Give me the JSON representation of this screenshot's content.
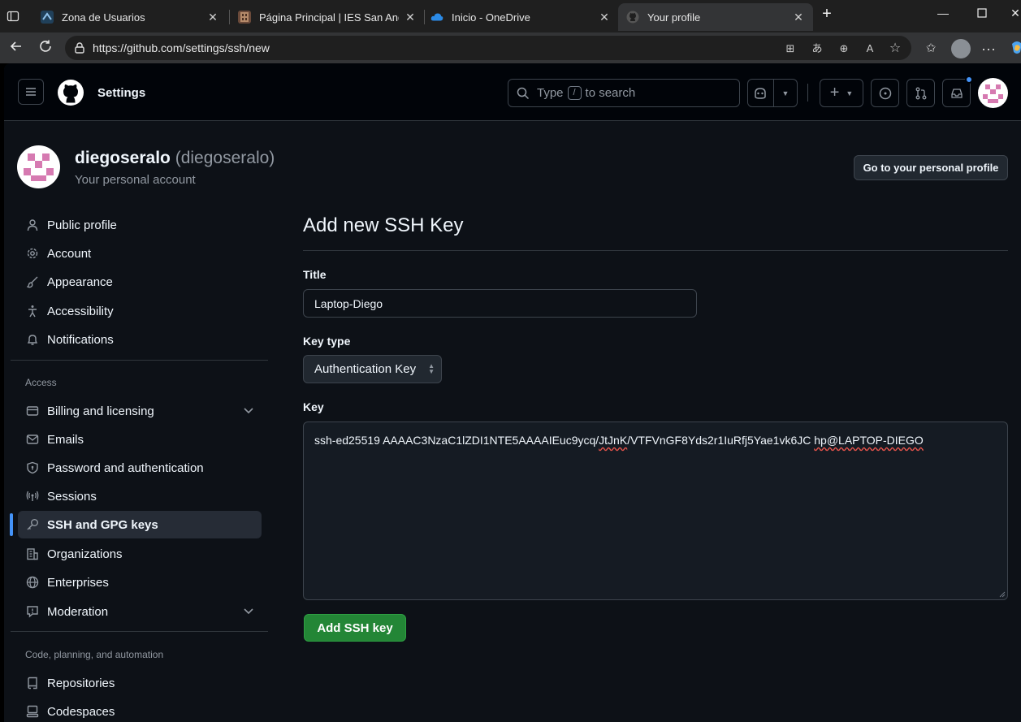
{
  "browser": {
    "tabs": [
      {
        "label": "Zona de Usuarios",
        "icon": "moodle-icon"
      },
      {
        "label": "Página Principal | IES San Andrés",
        "icon": "school-icon"
      },
      {
        "label": "Inicio - OneDrive",
        "icon": "onedrive-icon"
      },
      {
        "label": "Your profile",
        "icon": "github-icon",
        "active": true
      }
    ],
    "url": "https://github.com/settings/ssh/new"
  },
  "header": {
    "title": "Settings",
    "search_prefix": "Type",
    "search_key": "/",
    "search_suffix": "to search"
  },
  "profile": {
    "name": "diegoseralo",
    "handle": "(diegoseralo)",
    "subtitle": "Your personal account",
    "go_profile_label": "Go to your personal profile"
  },
  "sidebar": {
    "items": [
      {
        "label": "Public profile",
        "icon": "person-icon"
      },
      {
        "label": "Account",
        "icon": "gear-icon"
      },
      {
        "label": "Appearance",
        "icon": "paintbrush-icon"
      },
      {
        "label": "Accessibility",
        "icon": "accessibility-icon"
      },
      {
        "label": "Notifications",
        "icon": "bell-icon"
      }
    ],
    "access_heading": "Access",
    "access_items": [
      {
        "label": "Billing and licensing",
        "icon": "credit-card-icon",
        "expandable": true
      },
      {
        "label": "Emails",
        "icon": "mail-icon"
      },
      {
        "label": "Password and authentication",
        "icon": "shield-lock-icon"
      },
      {
        "label": "Sessions",
        "icon": "broadcast-icon"
      },
      {
        "label": "SSH and GPG keys",
        "icon": "key-icon",
        "selected": true
      },
      {
        "label": "Organizations",
        "icon": "organization-icon"
      },
      {
        "label": "Enterprises",
        "icon": "globe-icon"
      },
      {
        "label": "Moderation",
        "icon": "report-icon",
        "expandable": true
      }
    ],
    "code_heading": "Code, planning, and automation",
    "code_items": [
      {
        "label": "Repositories",
        "icon": "repo-icon"
      },
      {
        "label": "Codespaces",
        "icon": "codespaces-icon"
      }
    ]
  },
  "main": {
    "title": "Add new SSH Key",
    "title_label": "Title",
    "title_value": "Laptop-Diego",
    "key_type_label": "Key type",
    "key_type_value": "Authentication Key",
    "key_label": "Key",
    "key_part1": "ssh-ed25519 AAAAC3NzaC1lZDI1NTE5AAAAIEuc9ycq/",
    "key_part2": "JtJnK",
    "key_part3": "/VTFVnGF8Yds2r1IuRfj5Yae1vk6JC ",
    "key_part4": "hp@LAPTOP-DIEGO",
    "submit_label": "Add SSH key"
  },
  "colors": {
    "accent": "#4493f8",
    "primary_button": "#238636",
    "background": "#0d1117",
    "header_background": "#010409"
  }
}
